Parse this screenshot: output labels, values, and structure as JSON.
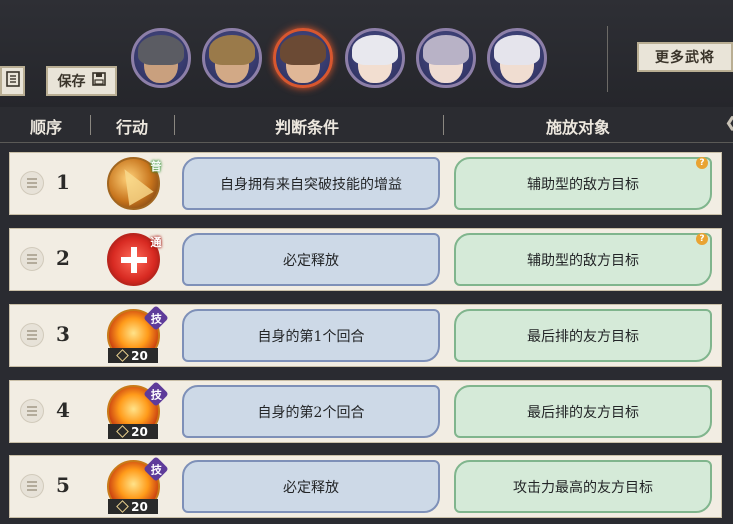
{
  "toolbar": {
    "save_label": "保存",
    "more_generals_label": "更多武将"
  },
  "portraits": [
    {
      "hair": "#5b5c63",
      "face": "#c9a07e",
      "selected": false
    },
    {
      "hair": "#9a7a4a",
      "face": "#d2a986",
      "selected": false
    },
    {
      "hair": "#6b4a34",
      "face": "#e0b797",
      "selected": true
    },
    {
      "hair": "#e8e8ee",
      "face": "#f2ded0",
      "selected": false
    },
    {
      "hair": "#b8b2c6",
      "face": "#efdcd2",
      "selected": false
    },
    {
      "hair": "#e5e4ec",
      "face": "#f0ddd1",
      "selected": false
    }
  ],
  "header": {
    "order": "顺序",
    "action": "行动",
    "condition": "判断条件",
    "target": "施放对象"
  },
  "rows": [
    {
      "order": "1",
      "icon": "gold-slash-skill-icon",
      "badge": "普",
      "cost": "",
      "condition": "自身拥有来自突破技能的增益",
      "target": "辅助型的敌方目标",
      "help": "?"
    },
    {
      "order": "2",
      "icon": "red-cross-skill-icon",
      "badge": "通",
      "cost": "",
      "condition": "必定释放",
      "target": "辅助型的敌方目标",
      "help": "?"
    },
    {
      "order": "3",
      "icon": "fire-skill-icon",
      "badge": "技",
      "cost": "20",
      "condition": "自身的第1个回合",
      "target": "最后排的友方目标",
      "help": ""
    },
    {
      "order": "4",
      "icon": "fire-skill-icon",
      "badge": "技",
      "cost": "20",
      "condition": "自身的第2个回合",
      "target": "最后排的友方目标",
      "help": ""
    },
    {
      "order": "5",
      "icon": "fire-skill-icon",
      "badge": "技",
      "cost": "20",
      "condition": "必定释放",
      "target": "攻击力最高的友方目标",
      "help": ""
    }
  ],
  "colors": {
    "condition_bg": "#cdd9e7",
    "target_bg": "#d5ead8",
    "highlight": "#d8572f"
  }
}
